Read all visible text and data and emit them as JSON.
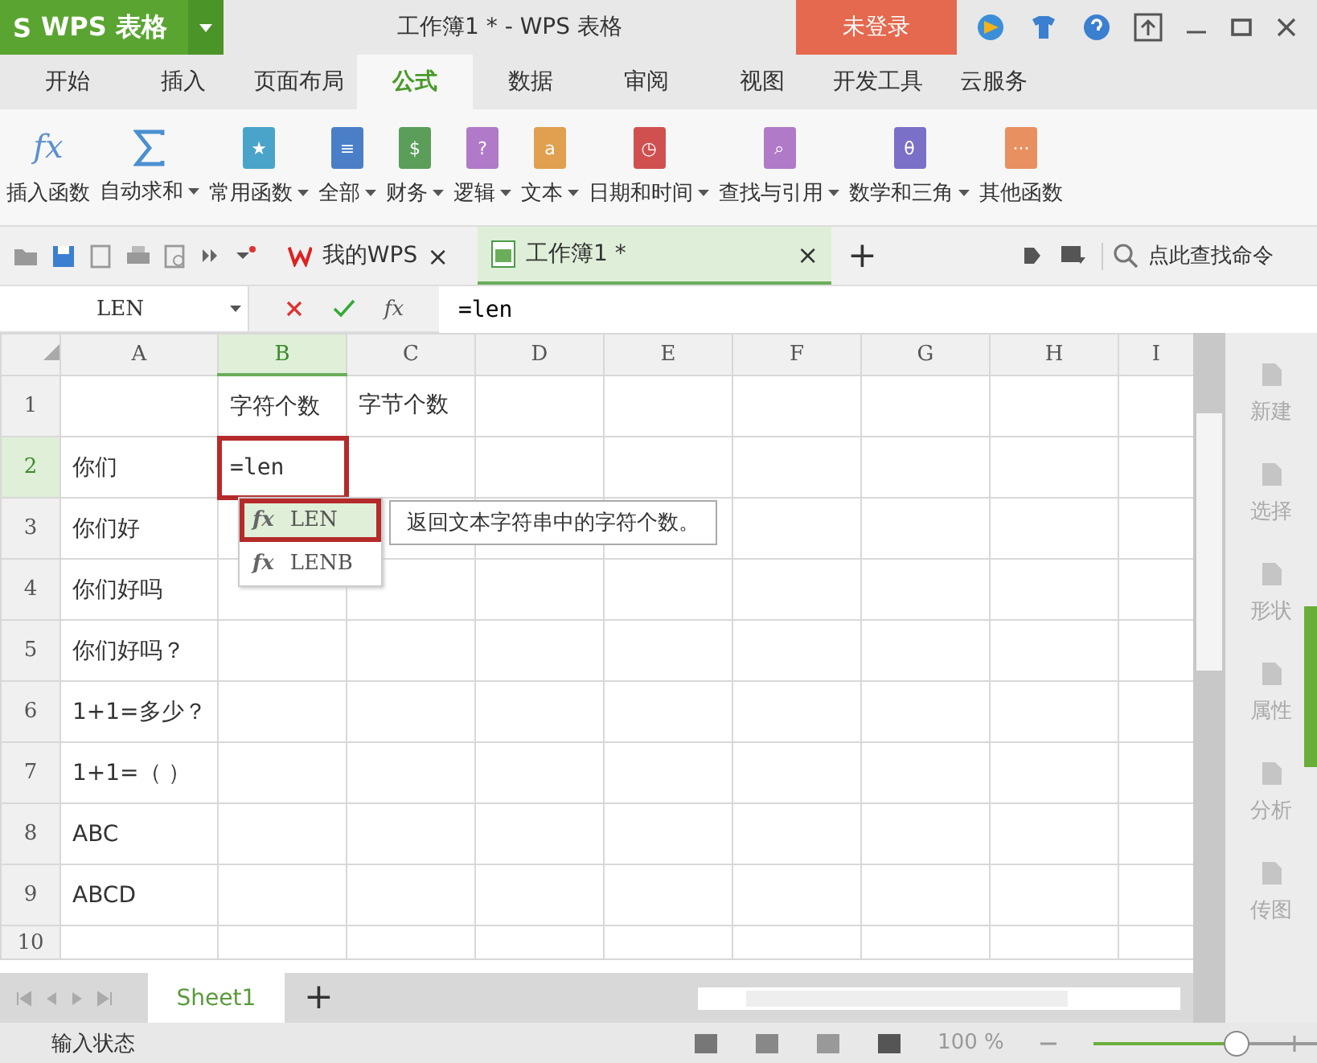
{
  "app_menu": {
    "logo": "S",
    "label": "WPS 表格"
  },
  "window": {
    "title": "工作簿1 * - WPS 表格",
    "login": "未登录"
  },
  "menu_tabs": [
    {
      "label": "开始",
      "selected": false
    },
    {
      "label": "插入",
      "selected": false
    },
    {
      "label": "页面布局",
      "selected": false
    },
    {
      "label": "公式",
      "selected": true
    },
    {
      "label": "数据",
      "selected": false
    },
    {
      "label": "审阅",
      "selected": false
    },
    {
      "label": "视图",
      "selected": false
    },
    {
      "label": "开发工具",
      "selected": false
    },
    {
      "label": "云服务",
      "selected": false
    }
  ],
  "ribbon": [
    {
      "kind": "fx",
      "label": "插入函数",
      "dropdown": false,
      "glyph": "fx"
    },
    {
      "kind": "sigma",
      "label": "自动求和",
      "dropdown": true
    },
    {
      "kind": "book",
      "label": "常用函数",
      "dropdown": true,
      "color": "#4aa3c8",
      "glyph": "★"
    },
    {
      "kind": "book",
      "label": "全部",
      "dropdown": true,
      "color": "#4a7fc8",
      "glyph": "≡"
    },
    {
      "kind": "book",
      "label": "财务",
      "dropdown": true,
      "color": "#5a9e5a",
      "glyph": "$"
    },
    {
      "kind": "book",
      "label": "逻辑",
      "dropdown": true,
      "color": "#b07ac8",
      "glyph": "?"
    },
    {
      "kind": "book",
      "label": "文本",
      "dropdown": true,
      "color": "#e0a050",
      "glyph": "a"
    },
    {
      "kind": "book",
      "label": "日期和时间",
      "dropdown": true,
      "color": "#d05050",
      "glyph": "◷"
    },
    {
      "kind": "book",
      "label": "查找与引用",
      "dropdown": true,
      "color": "#b07ac8",
      "glyph": "⌕"
    },
    {
      "kind": "book",
      "label": "数学和三角",
      "dropdown": true,
      "color": "#7a70c8",
      "glyph": "θ"
    },
    {
      "kind": "book",
      "label": "其他函数",
      "dropdown": false,
      "color": "#e89060",
      "glyph": "···"
    }
  ],
  "doc_tabs": [
    {
      "label": "我的WPS",
      "selected": false,
      "close": "×"
    },
    {
      "label": "工作簿1 *",
      "selected": true,
      "close": "×"
    }
  ],
  "new_tab": "+",
  "command_search": {
    "placeholder": "点此查找命令"
  },
  "formula_bar": {
    "name_box": "LEN",
    "fx": "fx",
    "formula": "=len"
  },
  "columns": [
    {
      "label": "A",
      "selected": false
    },
    {
      "label": "B",
      "selected": true
    },
    {
      "label": "C",
      "selected": false
    },
    {
      "label": "D",
      "selected": false
    },
    {
      "label": "E",
      "selected": false
    },
    {
      "label": "F",
      "selected": false
    },
    {
      "label": "G",
      "selected": false
    },
    {
      "label": "H",
      "selected": false
    },
    {
      "label": "I",
      "selected": false
    }
  ],
  "rows": [
    {
      "label": "1",
      "selected": false,
      "cells": [
        "",
        "字符个数",
        "字节个数",
        "",
        "",
        "",
        "",
        "",
        ""
      ]
    },
    {
      "label": "2",
      "selected": true,
      "cells": [
        "你们",
        "=len",
        "",
        "",
        "",
        "",
        "",
        "",
        ""
      ]
    },
    {
      "label": "3",
      "selected": false,
      "cells": [
        "你们好",
        "",
        "",
        "",
        "",
        "",
        "",
        "",
        ""
      ]
    },
    {
      "label": "4",
      "selected": false,
      "cells": [
        "你们好吗",
        "",
        "",
        "",
        "",
        "",
        "",
        "",
        ""
      ]
    },
    {
      "label": "5",
      "selected": false,
      "cells": [
        "你们好吗？",
        "",
        "",
        "",
        "",
        "",
        "",
        "",
        ""
      ]
    },
    {
      "label": "6",
      "selected": false,
      "cells": [
        "1+1=多少？",
        "",
        "",
        "",
        "",
        "",
        "",
        "",
        ""
      ]
    },
    {
      "label": "7",
      "selected": false,
      "cells": [
        "1+1=（ ）",
        "",
        "",
        "",
        "",
        "",
        "",
        "",
        ""
      ]
    },
    {
      "label": "8",
      "selected": false,
      "cells": [
        "ABC",
        "",
        "",
        "",
        "",
        "",
        "",
        "",
        ""
      ]
    },
    {
      "label": "9",
      "selected": false,
      "cells": [
        "ABCD",
        "",
        "",
        "",
        "",
        "",
        "",
        "",
        ""
      ]
    },
    {
      "label": "10",
      "selected": false,
      "cells": [
        "",
        "",
        "",
        "",
        "",
        "",
        "",
        "",
        ""
      ]
    }
  ],
  "autocomplete": {
    "items": [
      {
        "icon": "fx",
        "label": "LEN",
        "selected": true
      },
      {
        "icon": "fx",
        "label": "LENB",
        "selected": false
      }
    ],
    "tooltip": "返回文本字符串中的字符个数。"
  },
  "side_panel": [
    "新建",
    "选择",
    "形状",
    "属性",
    "分析",
    "传图"
  ],
  "sheet_tabs": [
    {
      "label": "Sheet1",
      "selected": true
    }
  ],
  "add_sheet": "+",
  "status": {
    "mode": "输入状态",
    "zoom": "100 %",
    "zoom_slider": {
      "level": 0.48
    }
  }
}
